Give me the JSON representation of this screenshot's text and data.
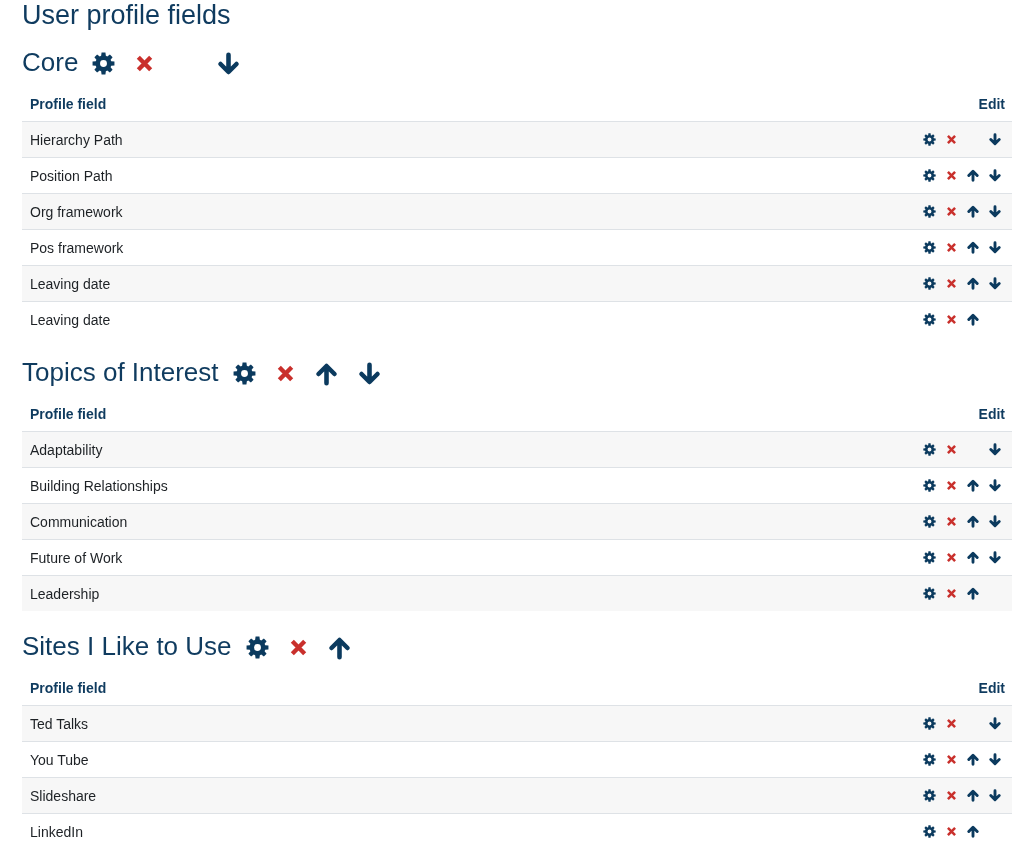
{
  "page": {
    "title": "User profile fields"
  },
  "categories": [
    {
      "name": "Core",
      "move_up": false,
      "move_down": true,
      "columns": [
        "Profile field",
        "Edit"
      ],
      "fields": [
        {
          "name": "Hierarchy Path",
          "move_up": false,
          "move_down": true
        },
        {
          "name": "Position Path",
          "move_up": true,
          "move_down": true
        },
        {
          "name": "Org framework",
          "move_up": true,
          "move_down": true
        },
        {
          "name": "Pos framework",
          "move_up": true,
          "move_down": true
        },
        {
          "name": "Leaving date",
          "move_up": true,
          "move_down": true
        },
        {
          "name": "Leaving date",
          "move_up": true,
          "move_down": false
        }
      ]
    },
    {
      "name": "Topics of Interest",
      "move_up": true,
      "move_down": true,
      "columns": [
        "Profile field",
        "Edit"
      ],
      "fields": [
        {
          "name": "Adaptability",
          "move_up": false,
          "move_down": true
        },
        {
          "name": "Building Relationships",
          "move_up": true,
          "move_down": true
        },
        {
          "name": "Communication",
          "move_up": true,
          "move_down": true
        },
        {
          "name": "Future of Work",
          "move_up": true,
          "move_down": true
        },
        {
          "name": "Leadership",
          "move_up": true,
          "move_down": false
        }
      ]
    },
    {
      "name": "Sites I Like to Use",
      "move_up": true,
      "move_down": false,
      "columns": [
        "Profile field",
        "Edit"
      ],
      "fields": [
        {
          "name": "Ted Talks",
          "move_up": false,
          "move_down": true
        },
        {
          "name": "You Tube",
          "move_up": true,
          "move_down": true
        },
        {
          "name": "Slideshare",
          "move_up": true,
          "move_down": true
        },
        {
          "name": "LinkedIn",
          "move_up": true,
          "move_down": false
        }
      ]
    }
  ]
}
